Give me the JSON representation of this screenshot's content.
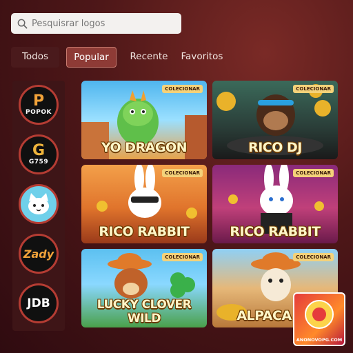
{
  "search": {
    "placeholder": "Pesquisrar logos"
  },
  "tabs": [
    {
      "label": "Todos"
    },
    {
      "label": "Popular",
      "active": true
    },
    {
      "label": "Recente"
    },
    {
      "label": "Favoritos"
    }
  ],
  "sidebar": {
    "providers": [
      {
        "name": "POPOK",
        "mark": "P"
      },
      {
        "name": "G759",
        "mark": "G"
      },
      {
        "name": "cat-logo"
      },
      {
        "name": "Zady"
      },
      {
        "name": "JDB"
      }
    ]
  },
  "games": [
    {
      "title": "YO DRAGON",
      "badge": "COLECIONAR"
    },
    {
      "title": "RICO DJ",
      "badge": "COLECIONAR"
    },
    {
      "title": "RICO RABBIT",
      "badge": "COLECIONAR"
    },
    {
      "title": "RICO RABBIT",
      "badge": "COLECIONAR"
    },
    {
      "title": "LUCKY CLOVER WILD",
      "badge": "COLECIONAR"
    },
    {
      "title": "ALPACA PA",
      "badge": "COLECIONAR"
    }
  ],
  "watermark": {
    "text": "ANONOVOPG.COM"
  },
  "colors": {
    "accent": "#8e3b36",
    "background": "#4e1718",
    "badge": "#f4d27a"
  }
}
